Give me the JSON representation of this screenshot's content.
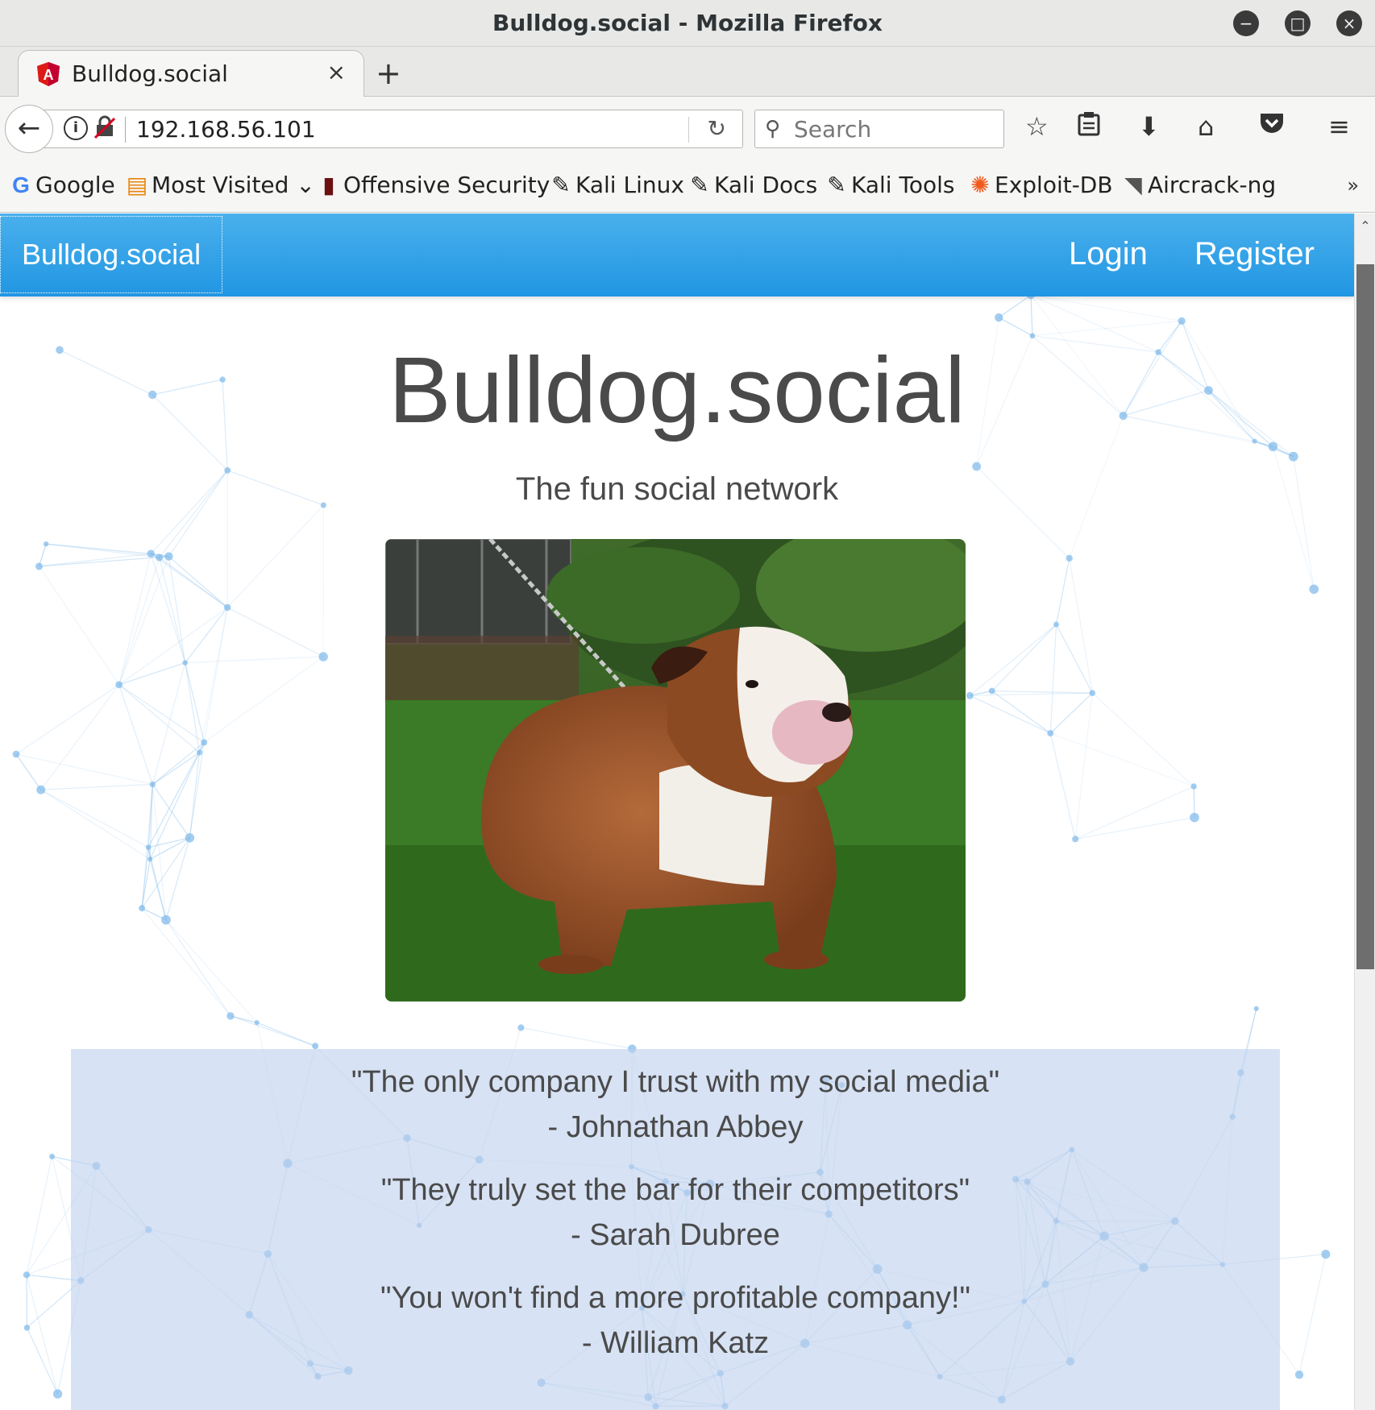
{
  "window": {
    "title": "Bulldog.social - Mozilla Firefox",
    "controls": {
      "minimize": "minimize-icon",
      "maximize": "maximize-icon",
      "close": "close-icon"
    }
  },
  "tab": {
    "title": "Bulldog.social",
    "favicon": "angular-icon",
    "close_glyph": "×",
    "new_tab_glyph": "+"
  },
  "urlbar": {
    "url": "192.168.56.101"
  },
  "searchbar": {
    "placeholder": "Search"
  },
  "bookmarks": [
    {
      "label": "Google",
      "icon": "google-icon"
    },
    {
      "label": "Most Visited",
      "icon": "most-visited-icon"
    },
    {
      "label": "Offensive Security",
      "icon": "offensive-security-icon"
    },
    {
      "label": "Kali Linux",
      "icon": "kali-icon"
    },
    {
      "label": "Kali Docs",
      "icon": "kali-icon"
    },
    {
      "label": "Kali Tools",
      "icon": "kali-icon"
    },
    {
      "label": "Exploit-DB",
      "icon": "exploit-db-icon"
    },
    {
      "label": "Aircrack-ng",
      "icon": "aircrack-icon"
    }
  ],
  "site": {
    "brand": "Bulldog.social",
    "nav": {
      "login": "Login",
      "register": "Register"
    },
    "hero": {
      "title": "Bulldog.social",
      "subtitle": "The fun social network"
    },
    "testimonials": [
      {
        "quote": "\"The only company I trust with my social media\"",
        "author": "- Johnathan Abbey"
      },
      {
        "quote": "\"They truly set the bar for their competitors\"",
        "author": "- Sarah Dubree"
      },
      {
        "quote": "\"You won't find a more profitable company!\"",
        "author": "- William Katz"
      }
    ]
  },
  "colors": {
    "navbar": "#2196e3",
    "testimonial_bg": "#d6e2f5",
    "text": "#4a4a4a",
    "network_lines": "#7cb8ea"
  }
}
